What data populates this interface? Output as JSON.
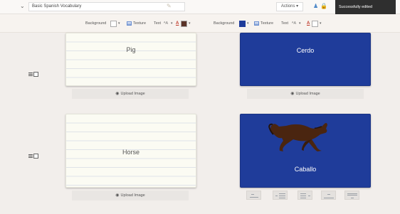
{
  "header": {
    "deck_title": "Basic Spanish Vocabulary",
    "actions_label": "Actions",
    "actions_caret": "▾",
    "toast": "Successfully edited",
    "icons": [
      "collapse-icon",
      "edit-icon",
      "pin-icon",
      "lock-icon"
    ]
  },
  "toolbars": [
    {
      "background_label": "Background",
      "texture_label": "Texture",
      "text_label": "Text",
      "font_glyph": "ᴬA",
      "color_glyph": "A",
      "bg_swatch": "#ffffff",
      "text_swatch": "#5a3327",
      "caret": "▾"
    },
    {
      "background_label": "Background",
      "texture_label": "Texture",
      "text_label": "Text",
      "font_glyph": "ᴬA",
      "color_glyph": "A",
      "bg_swatch": "#1f3c9a",
      "text_swatch": "#ffffff",
      "caret": "▾"
    }
  ],
  "cards": [
    {
      "front": "Pig",
      "back": "Cerdo"
    },
    {
      "front": "Horse",
      "back": "Caballo"
    }
  ],
  "upload_label": "Upload Image",
  "upload_icon": "camera-icon",
  "layout_options": [
    "image-left-layout",
    "image-right-layout",
    "text-left-layout",
    "image-bottom-layout",
    "text-top-layout"
  ],
  "colors": {
    "card_dark": "#1f3c9a",
    "card_light": "#fbfbf3",
    "toast_bg": "#2f2f2f",
    "page_bg": "#f2eeeb"
  }
}
